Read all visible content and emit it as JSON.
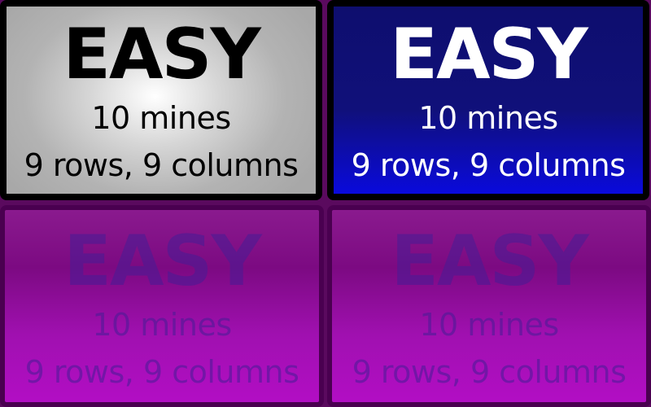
{
  "tiles": [
    {
      "title": "EASY",
      "mines": "10 mines",
      "dims": "9 rows, 9 columns",
      "state": "hover"
    },
    {
      "title": "EASY",
      "mines": "10 mines",
      "dims": "9 rows, 9 columns",
      "state": "selected"
    },
    {
      "title": "EASY",
      "mines": "10 mines",
      "dims": "9 rows, 9 columns",
      "state": "disabled"
    },
    {
      "title": "EASY",
      "mines": "10 mines",
      "dims": "9 rows, 9 columns",
      "state": "disabled"
    }
  ],
  "colors": {
    "hover_bg": "#b3b3b3",
    "selected_bg": "#10107a",
    "selected_bottom": "#0a0adc",
    "disabled_bg": "#9a10a8",
    "border": "#000000"
  }
}
